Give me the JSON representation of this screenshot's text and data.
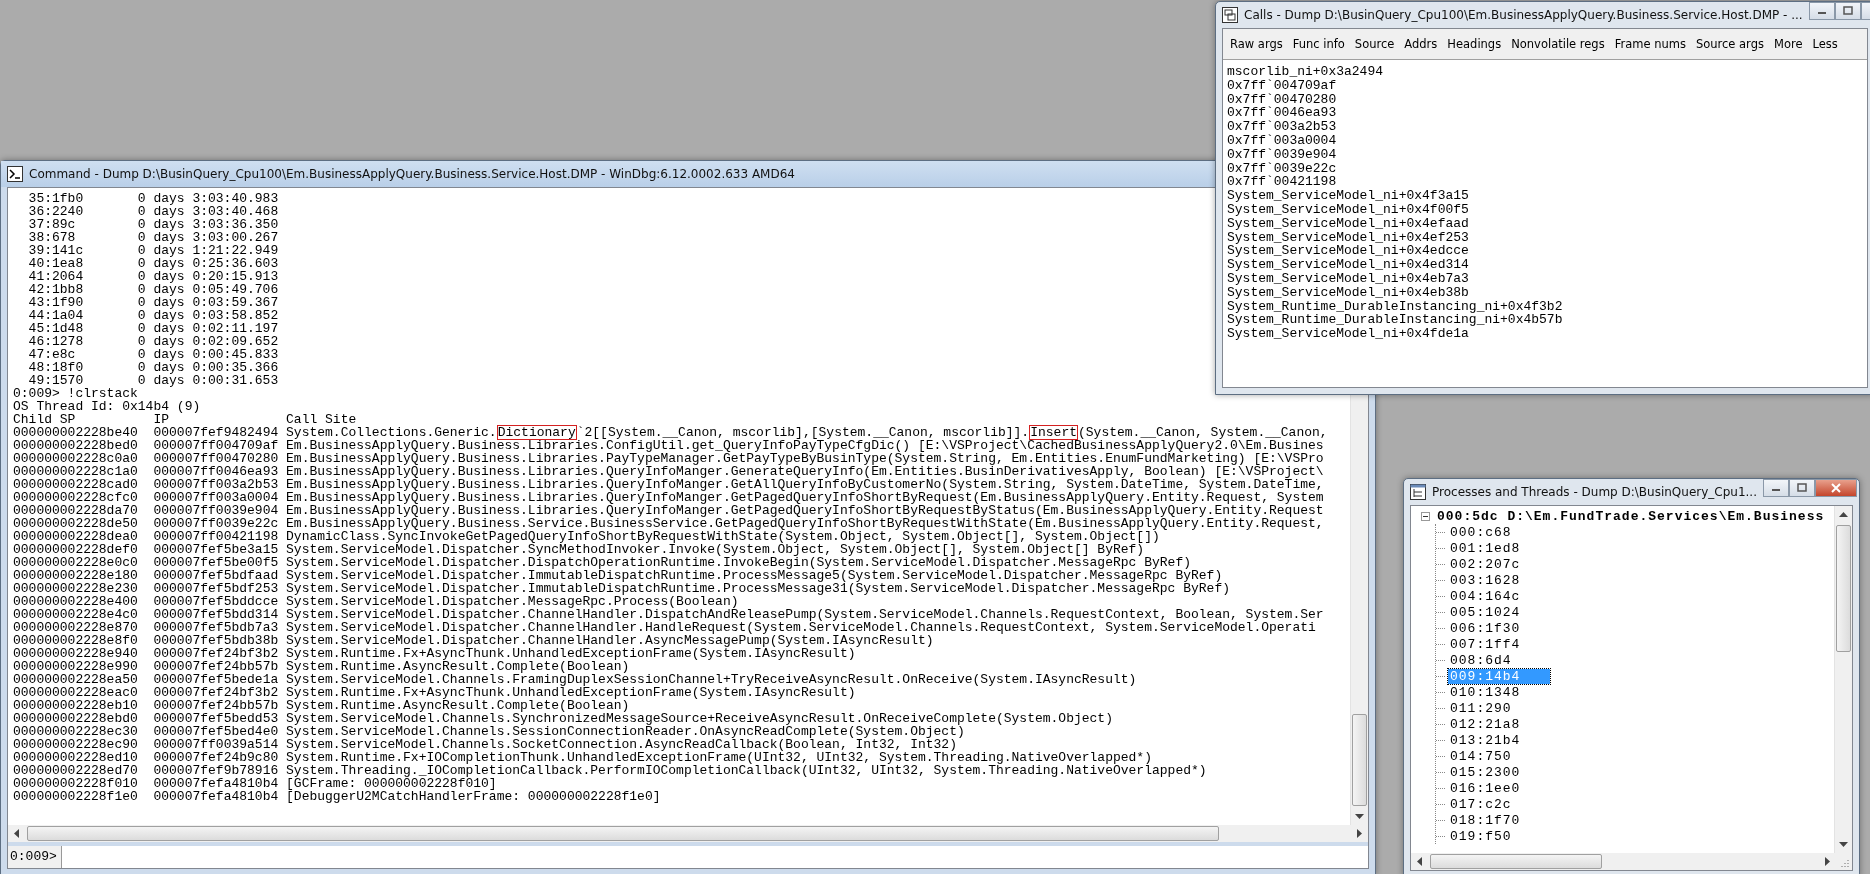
{
  "command_window": {
    "title": "Command - Dump D:\\BusinQuery_Cpu100\\Em.BusinessApplyQuery.Business.Service.Host.DMP - WinDbg:6.12.0002.633 AMD64",
    "thread_times": [
      {
        "thread": "35:1fb0",
        "elapsed": "0 days 3:03:40.983"
      },
      {
        "thread": "36:2240",
        "elapsed": "0 days 3:03:40.468"
      },
      {
        "thread": "37:89c",
        "elapsed": "0 days 3:03:36.350"
      },
      {
        "thread": "38:678",
        "elapsed": "0 days 3:03:00.267"
      },
      {
        "thread": "39:141c",
        "elapsed": "0 days 1:21:22.949"
      },
      {
        "thread": "40:1ea8",
        "elapsed": "0 days 0:25:36.603"
      },
      {
        "thread": "41:2064",
        "elapsed": "0 days 0:20:15.913"
      },
      {
        "thread": "42:1bb8",
        "elapsed": "0 days 0:05:49.706"
      },
      {
        "thread": "43:1f90",
        "elapsed": "0 days 0:03:59.367"
      },
      {
        "thread": "44:1a04",
        "elapsed": "0 days 0:03:58.852"
      },
      {
        "thread": "45:1d48",
        "elapsed": "0 days 0:02:11.197"
      },
      {
        "thread": "46:1278",
        "elapsed": "0 days 0:02:09.652"
      },
      {
        "thread": "47:e8c",
        "elapsed": "0 days 0:00:45.833"
      },
      {
        "thread": "48:18f0",
        "elapsed": "0 days 0:00:35.366"
      },
      {
        "thread": "49:1570",
        "elapsed": "0 days 0:00:31.653"
      }
    ],
    "command_echo": "0:009> !clrstack",
    "os_thread": "OS Thread Id: 0x14b4 (9)",
    "columns": [
      "Child SP",
      "IP",
      "Call Site"
    ],
    "frames": [
      {
        "child_sp": "000000002228be40",
        "ip": "000007fef9482494",
        "call_site": [
          {
            "text": "System.Collections.Generic.",
            "boxed": false
          },
          {
            "text": "Dictionary",
            "boxed": true
          },
          {
            "text": "`2[[System.__Canon, mscorlib],[System.__Canon, mscorlib]].",
            "boxed": false
          },
          {
            "text": "Insert",
            "boxed": true
          },
          {
            "text": "(System.__Canon, System.__Canon,",
            "boxed": false
          }
        ]
      },
      {
        "child_sp": "000000002228bed0",
        "ip": "000007ff004709af",
        "call_site": [
          {
            "text": "Em.BusinessApplyQuery.Business.Libraries.ConfigUtil.get_QueryInfoPayTypeCfgDic() [E:\\VSProject\\CachedBusinessApplyQuery2.0\\Em.Busines",
            "boxed": false
          }
        ]
      },
      {
        "child_sp": "000000002228c0a0",
        "ip": "000007ff00470280",
        "call_site": [
          {
            "text": "Em.BusinessApplyQuery.Business.Libraries.PayTypeManager.GetPayTypeByBusinType(System.String, Em.Entities.EnumFundMarketing) [E:\\VSPro",
            "boxed": false
          }
        ]
      },
      {
        "child_sp": "000000002228c1a0",
        "ip": "000007ff0046ea93",
        "call_site": [
          {
            "text": "Em.BusinessApplyQuery.Business.Libraries.QueryInfoManger.GenerateQueryInfo(Em.Entities.BusinDerivativesApply, Boolean) [E:\\VSProject\\",
            "boxed": false
          }
        ]
      },
      {
        "child_sp": "000000002228cad0",
        "ip": "000007ff003a2b53",
        "call_site": [
          {
            "text": "Em.BusinessApplyQuery.Business.Libraries.QueryInfoManger.GetAllQueryInfoByCustomerNo(System.String, System.DateTime, System.DateTime,",
            "boxed": false
          }
        ]
      },
      {
        "child_sp": "000000002228cfc0",
        "ip": "000007ff003a0004",
        "call_site": [
          {
            "text": "Em.BusinessApplyQuery.Business.Libraries.QueryInfoManger.GetPagedQueryInfoShortByRequest(Em.BusinessApplyQuery.Entity.Request, System",
            "boxed": false
          }
        ]
      },
      {
        "child_sp": "000000002228da70",
        "ip": "000007ff0039e904",
        "call_site": [
          {
            "text": "Em.BusinessApplyQuery.Business.Libraries.QueryInfoManger.GetPagedQueryInfoShortByRequestByStatus(Em.BusinessApplyQuery.Entity.Request",
            "boxed": false
          }
        ]
      },
      {
        "child_sp": "000000002228de50",
        "ip": "000007ff0039e22c",
        "call_site": [
          {
            "text": "Em.BusinessApplyQuery.Business.Service.BusinessService.GetPagedQueryInfoShortByRequestWithState(Em.BusinessApplyQuery.Entity.Request,",
            "boxed": false
          }
        ]
      },
      {
        "child_sp": "000000002228dea0",
        "ip": "000007ff00421198",
        "call_site": [
          {
            "text": "DynamicClass.SyncInvokeGetPagedQueryInfoShortByRequestWithState(System.Object, System.Object[], System.Object[])",
            "boxed": false
          }
        ]
      },
      {
        "child_sp": "000000002228def0",
        "ip": "000007fef5be3a15",
        "call_site": [
          {
            "text": "System.ServiceModel.Dispatcher.SyncMethodInvoker.Invoke(System.Object, System.Object[], System.Object[] ByRef)",
            "boxed": false
          }
        ]
      },
      {
        "child_sp": "000000002228e0c0",
        "ip": "000007fef5be00f5",
        "call_site": [
          {
            "text": "System.ServiceModel.Dispatcher.DispatchOperationRuntime.InvokeBegin(System.ServiceModel.Dispatcher.MessageRpc ByRef)",
            "boxed": false
          }
        ]
      },
      {
        "child_sp": "000000002228e180",
        "ip": "000007fef5bdfaad",
        "call_site": [
          {
            "text": "System.ServiceModel.Dispatcher.ImmutableDispatchRuntime.ProcessMessage5(System.ServiceModel.Dispatcher.MessageRpc ByRef)",
            "boxed": false
          }
        ]
      },
      {
        "child_sp": "000000002228e230",
        "ip": "000007fef5bdf253",
        "call_site": [
          {
            "text": "System.ServiceModel.Dispatcher.ImmutableDispatchRuntime.ProcessMessage31(System.ServiceModel.Dispatcher.MessageRpc ByRef)",
            "boxed": false
          }
        ]
      },
      {
        "child_sp": "000000002228e400",
        "ip": "000007fef5bddcce",
        "call_site": [
          {
            "text": "System.ServiceModel.Dispatcher.MessageRpc.Process(Boolean)",
            "boxed": false
          }
        ]
      },
      {
        "child_sp": "000000002228e4c0",
        "ip": "000007fef5bdd314",
        "call_site": [
          {
            "text": "System.ServiceModel.Dispatcher.ChannelHandler.DispatchAndReleasePump(System.ServiceModel.Channels.RequestContext, Boolean, System.Ser",
            "boxed": false
          }
        ]
      },
      {
        "child_sp": "000000002228e870",
        "ip": "000007fef5bdb7a3",
        "call_site": [
          {
            "text": "System.ServiceModel.Dispatcher.ChannelHandler.HandleRequest(System.ServiceModel.Channels.RequestContext, System.ServiceModel.Operati",
            "boxed": false
          }
        ]
      },
      {
        "child_sp": "000000002228e8f0",
        "ip": "000007fef5bdb38b",
        "call_site": [
          {
            "text": "System.ServiceModel.Dispatcher.ChannelHandler.AsyncMessagePump(System.IAsyncResult)",
            "boxed": false
          }
        ]
      },
      {
        "child_sp": "000000002228e940",
        "ip": "000007fef24bf3b2",
        "call_site": [
          {
            "text": "System.Runtime.Fx+AsyncThunk.UnhandledExceptionFrame(System.IAsyncResult)",
            "boxed": false
          }
        ]
      },
      {
        "child_sp": "000000002228e990",
        "ip": "000007fef24bb57b",
        "call_site": [
          {
            "text": "System.Runtime.AsyncResult.Complete(Boolean)",
            "boxed": false
          }
        ]
      },
      {
        "child_sp": "000000002228ea50",
        "ip": "000007fef5bede1a",
        "call_site": [
          {
            "text": "System.ServiceModel.Channels.FramingDuplexSessionChannel+TryReceiveAsyncResult.OnReceive(System.IAsyncResult)",
            "boxed": false
          }
        ]
      },
      {
        "child_sp": "000000002228eac0",
        "ip": "000007fef24bf3b2",
        "call_site": [
          {
            "text": "System.Runtime.Fx+AsyncThunk.UnhandledExceptionFrame(System.IAsyncResult)",
            "boxed": false
          }
        ]
      },
      {
        "child_sp": "000000002228eb10",
        "ip": "000007fef24bb57b",
        "call_site": [
          {
            "text": "System.Runtime.AsyncResult.Complete(Boolean)",
            "boxed": false
          }
        ]
      },
      {
        "child_sp": "000000002228ebd0",
        "ip": "000007fef5bedd53",
        "call_site": [
          {
            "text": "System.ServiceModel.Channels.SynchronizedMessageSource+ReceiveAsyncResult.OnReceiveComplete(System.Object)",
            "boxed": false
          }
        ]
      },
      {
        "child_sp": "000000002228ec30",
        "ip": "000007fef5bed4e0",
        "call_site": [
          {
            "text": "System.ServiceModel.Channels.SessionConnectionReader.OnAsyncReadComplete(System.Object)",
            "boxed": false
          }
        ]
      },
      {
        "child_sp": "000000002228ec90",
        "ip": "000007ff0039a514",
        "call_site": [
          {
            "text": "System.ServiceModel.Channels.SocketConnection.AsyncReadCallback(Boolean, Int32, Int32)",
            "boxed": false
          }
        ]
      },
      {
        "child_sp": "000000002228ed10",
        "ip": "000007fef24b9c80",
        "call_site": [
          {
            "text": "System.Runtime.Fx+IOCompletionThunk.UnhandledExceptionFrame(UInt32, UInt32, System.Threading.NativeOverlapped*)",
            "boxed": false
          }
        ]
      },
      {
        "child_sp": "000000002228ed70",
        "ip": "000007fef9b78916",
        "call_site": [
          {
            "text": "System.Threading._IOCompletionCallback.PerformIOCompletionCallback(UInt32, UInt32, System.Threading.NativeOverlapped*)",
            "boxed": false
          }
        ]
      },
      {
        "child_sp": "000000002228f010",
        "ip": "000007fefa4810b4",
        "call_site": [
          {
            "text": "[GCFrame: 000000002228f010]",
            "boxed": false
          }
        ]
      },
      {
        "child_sp": "000000002228f1e0",
        "ip": "000007fefa4810b4",
        "call_site": [
          {
            "text": "[DebuggerU2MCatchHandlerFrame: 000000002228f1e0]",
            "boxed": false
          }
        ]
      }
    ],
    "input_prompt": "0:009>"
  },
  "calls_window": {
    "title": "Calls - Dump D:\\BusinQuery_Cpu100\\Em.BusinessApplyQuery.Business.Service.Host.DMP - ...",
    "toolbar": [
      "Raw args",
      "Func info",
      "Source",
      "Addrs",
      "Headings",
      "Nonvolatile regs",
      "Frame nums",
      "Source args",
      "More",
      "Less"
    ],
    "entries": [
      "mscorlib_ni+0x3a2494",
      "0x7ff`004709af",
      "0x7ff`00470280",
      "0x7ff`0046ea93",
      "0x7ff`003a2b53",
      "0x7ff`003a0004",
      "0x7ff`0039e904",
      "0x7ff`0039e22c",
      "0x7ff`00421198",
      "System_ServiceModel_ni+0x4f3a15",
      "System_ServiceModel_ni+0x4f00f5",
      "System_ServiceModel_ni+0x4efaad",
      "System_ServiceModel_ni+0x4ef253",
      "System_ServiceModel_ni+0x4edcce",
      "System_ServiceModel_ni+0x4ed314",
      "System_ServiceModel_ni+0x4eb7a3",
      "System_ServiceModel_ni+0x4eb38b",
      "System_Runtime_DurableInstancing_ni+0x4f3b2",
      "System_Runtime_DurableInstancing_ni+0x4b57b",
      "System_ServiceModel_ni+0x4fde1a"
    ]
  },
  "processes_window": {
    "title": "Processes and Threads - Dump D:\\BusinQuery_Cpu1...",
    "tree": [
      {
        "label": "000:5dc D:\\Em.FundTrade.Services\\Em.Business",
        "expanded": true,
        "selected": false,
        "children": [
          {
            "label": "000:c68",
            "selected": false
          },
          {
            "label": "001:1ed8",
            "selected": false
          },
          {
            "label": "002:207c",
            "selected": false
          },
          {
            "label": "003:1628",
            "selected": false
          },
          {
            "label": "004:164c",
            "selected": false
          },
          {
            "label": "005:1024",
            "selected": false
          },
          {
            "label": "006:1f30",
            "selected": false
          },
          {
            "label": "007:1ff4",
            "selected": false
          },
          {
            "label": "008:6d4",
            "selected": false
          },
          {
            "label": "009:14b4",
            "selected": true
          },
          {
            "label": "010:1348",
            "selected": false
          },
          {
            "label": "011:290",
            "selected": false
          },
          {
            "label": "012:21a8",
            "selected": false
          },
          {
            "label": "013:21b4",
            "selected": false
          },
          {
            "label": "014:750",
            "selected": false
          },
          {
            "label": "015:2300",
            "selected": false
          },
          {
            "label": "016:1ee0",
            "selected": false
          },
          {
            "label": "017:c2c",
            "selected": false
          },
          {
            "label": "018:1f70",
            "selected": false
          },
          {
            "label": "019:f50",
            "selected": false
          }
        ]
      }
    ]
  }
}
